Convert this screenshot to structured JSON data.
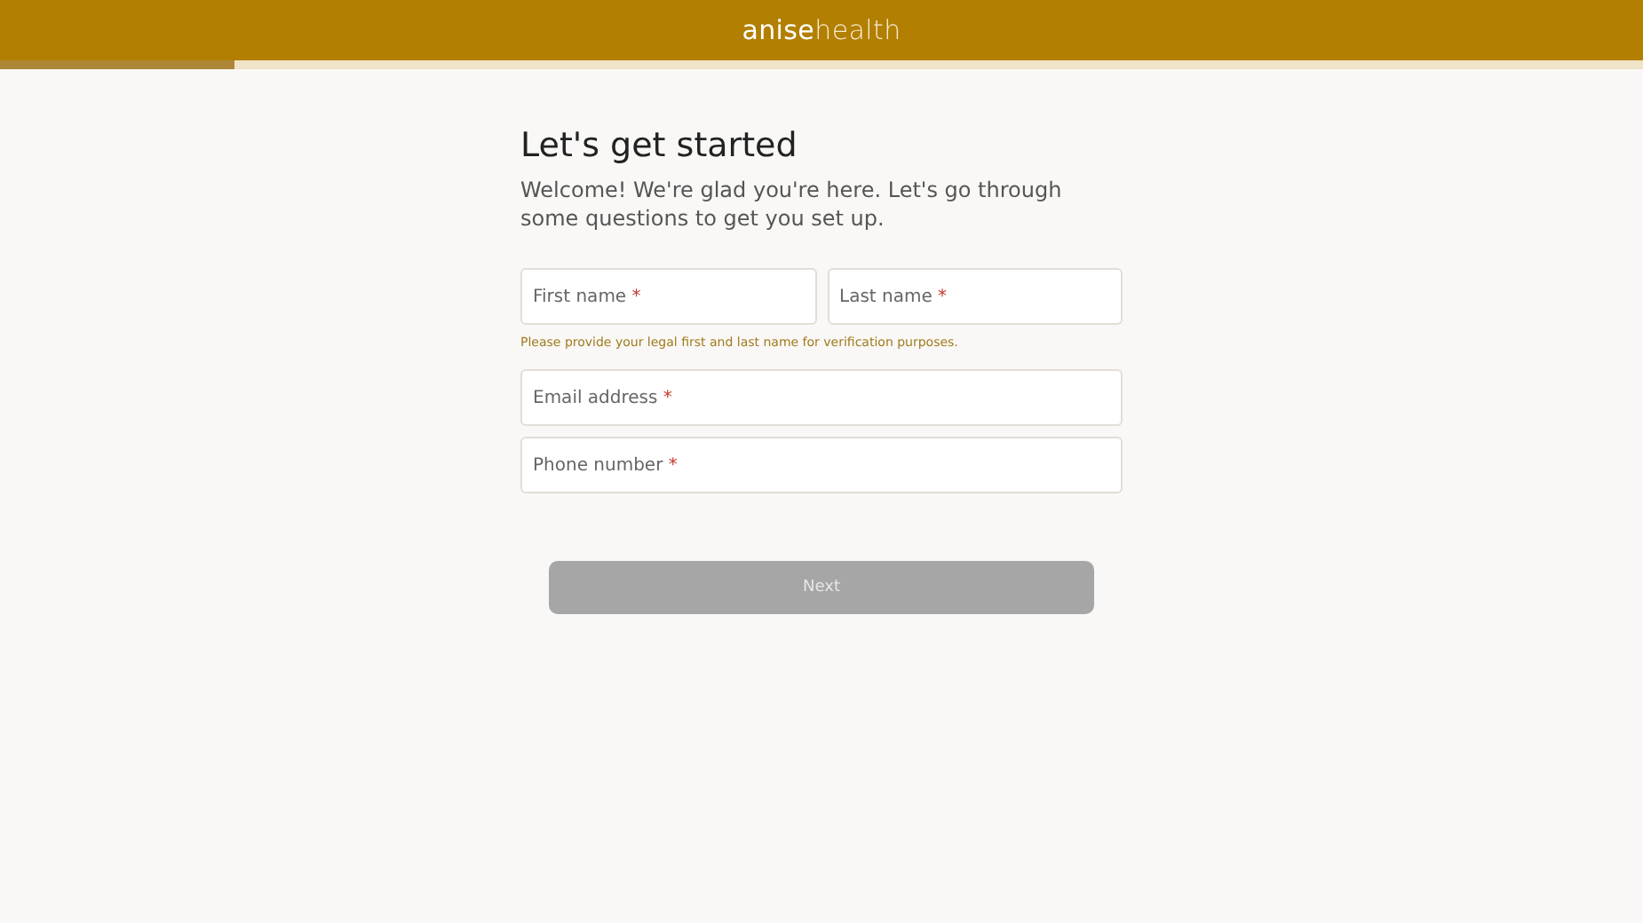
{
  "header": {
    "logo": "**anise**health"
  },
  "progress": {
    "level": 0.143
  },
  "title": "Let's get started",
  "subtitle": "Welcome! We're glad you're here. Let's go through some questions to get you set up.",
  "name_fields": [
    {
      "label": "First name",
      "required_mark": "*"
    },
    {
      "label": "Last name",
      "required_mark": "*"
    }
  ],
  "hint": "Please provide your legal first and last name for verification purposes.",
  "fields": [
    {
      "label": "Email address",
      "required_mark": "*"
    },
    {
      "label": "Phone number",
      "required_mark": "*"
    }
  ],
  "next_button": {
    "label": "Next",
    "disabled": true
  }
}
